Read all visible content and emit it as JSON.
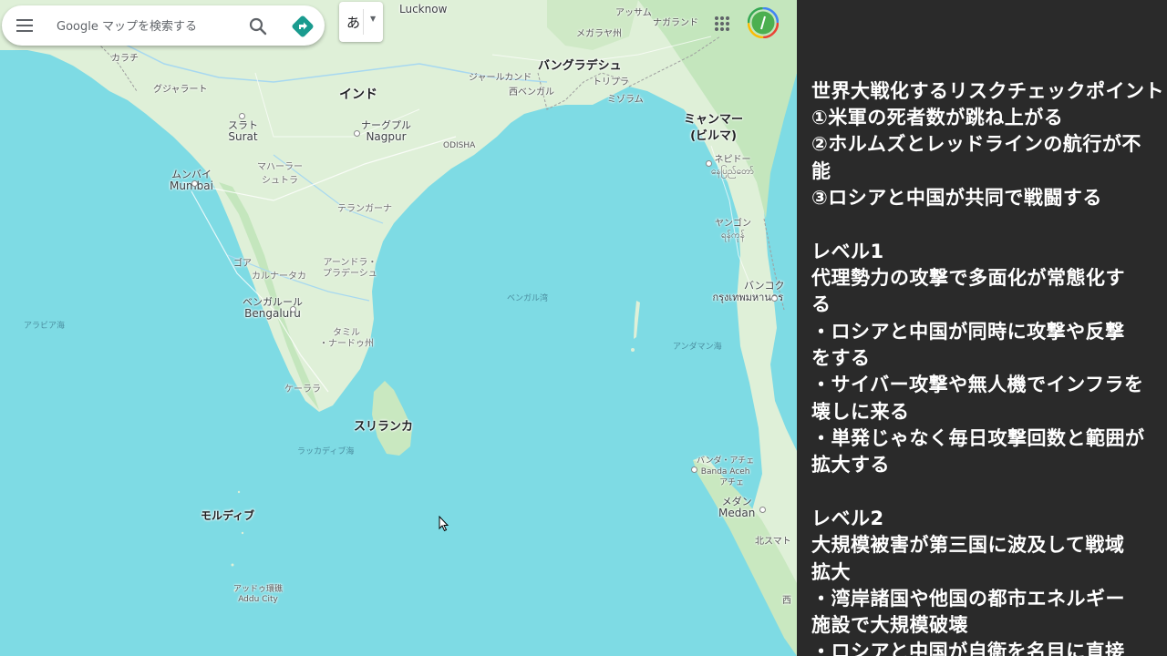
{
  "search": {
    "placeholder": "Google マップを検索する"
  },
  "ime": {
    "char": "あ"
  },
  "icons": {
    "menu": "menu-icon",
    "search": "search-icon",
    "directions": "directions-icon",
    "apps": "apps-grid-icon",
    "avatar": "account-avatar-icon",
    "cursor": "mouse-cursor-icon"
  },
  "colors": {
    "sea": "#7edbe4",
    "land": "#dff0d8",
    "land_green": "#b8e0b0",
    "overlay_bg": "#2a2a2a",
    "overlay_text": "#ffffff",
    "directions_accent": "#1a9b8f"
  },
  "map": {
    "labels": {
      "lucknow": "Lucknow",
      "assam": "アッサム",
      "nagaland": "ナガランド",
      "meghalaya": "メガラヤ州",
      "karachi": "カラチ",
      "gujarat": "グジャラート",
      "india": "インド",
      "jharkhand": "ジャールカンド",
      "bangladesh": "バングラデシュ",
      "west_bengal": "西ベンガル",
      "tripura": "トリプラ",
      "mizoram": "ミゾラム",
      "surat_ja": "スラト",
      "surat_en": "Surat",
      "nagpur_ja": "ナーグプル",
      "nagpur_en": "Nagpur",
      "odisha": "ODISHA",
      "myanmar_ja": "ミャンマー",
      "myanmar_sub": "(ビルマ)",
      "naypyidaw_ja": "ネピドー",
      "naypyidaw_my": "နေပြည်တော်",
      "maharashtra_1": "マハーラー",
      "maharashtra_2": "シュトラ",
      "mumbai_ja": "ムンバイ",
      "mumbai_en": "Mumbai",
      "telangana": "テランガーナ",
      "yangon_ja": "ヤンゴン",
      "yangon_my": "ရန်ကုန်",
      "goa": "ゴア",
      "karnataka": "カルナータカ",
      "andhra_1": "アーンドラ・",
      "andhra_2": "プラデーシュ",
      "bangkok_ja": "バンコク",
      "bangkok_th": "กรุงเทพมหานคร",
      "bengaluru_ja": "ベンガルール",
      "bengaluru_en": "Bengaluru",
      "bay_of_bengal": "ベンガル湾",
      "arabian_sea": "アラビア海",
      "tamil_1": "タミル",
      "tamil_2": "・ナードゥ州",
      "andaman_sea": "アンダマン海",
      "kerala": "ケーララ",
      "sri_lanka": "スリランカ",
      "laccadive_sea": "ラッカディブ海",
      "banda_aceh_ja": "バンダ・アチェ",
      "banda_aceh_en": "Banda Aceh",
      "aceh": "アチェ",
      "maldives": "モルディブ",
      "medan_ja": "メダン",
      "medan_en": "Medan",
      "north_sumatra": "北スマト",
      "addu_ja": "アッドゥ環礁",
      "addu_en": "Addu City",
      "west_edge": "西"
    }
  },
  "overlay": {
    "lines": [
      "世界大戦化するリスクチェックポイント",
      "①米軍の死者数が跳ね上がる",
      "②ホルムズとレッドラインの航行が不",
      "能",
      "③ロシアと中国が共同で戦闘する",
      "",
      "レベル1",
      "代理勢力の攻撃で多面化が常態化す",
      "る",
      "・ロシアと中国が同時に攻撃や反撃",
      "をする",
      "・サイバー攻撃や無人機でインフラを",
      "壊しに来る",
      "・単発じゃなく毎日攻撃回数と範囲が",
      "拡大する",
      "",
      "レベル2",
      "大規模被害が第三国に波及して戦域",
      "拡大",
      "・湾岸諸国や他国の都市エネルギー",
      "施設で大規模破壊",
      "・ロシアと中国が自衛を名目に直接"
    ]
  }
}
